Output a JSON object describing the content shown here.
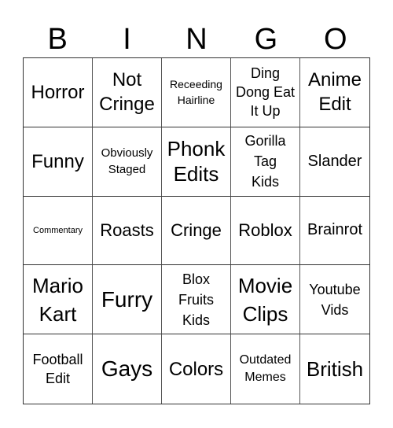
{
  "header": {
    "letters": [
      "B",
      "I",
      "N",
      "G",
      "O"
    ]
  },
  "grid": {
    "rows": [
      [
        "Horror",
        "Not Cringe",
        "Receeding Hairline",
        "Ding Dong Eat It Up",
        "Anime Edit"
      ],
      [
        "Funny",
        "Obviously Staged",
        "Phonk Edits",
        "Gorilla Tag Kids",
        "Slander"
      ],
      [
        "Commentary",
        "Roasts",
        "Cringe",
        "Roblox",
        "Brainrot"
      ],
      [
        "Mario Kart",
        "Furry",
        "Blox Fruits Kids",
        "Movie Clips",
        "Youtube Vids"
      ],
      [
        "Football Edit",
        "Gays",
        "Colors",
        "Outdated Memes",
        "British"
      ]
    ]
  }
}
